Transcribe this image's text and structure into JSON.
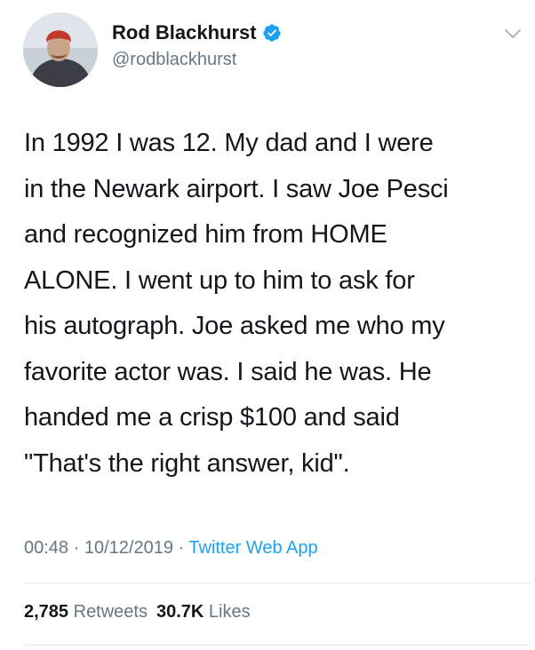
{
  "user": {
    "display_name": "Rod Blackhurst",
    "handle": "@rodblackhurst",
    "verified": true
  },
  "tweet": {
    "lines": [
      "In 1992 I was 12. My dad and I were",
      "in the Newark airport. I saw Joe Pesci",
      "and recognized him from HOME",
      "ALONE. I went up to him to ask for",
      "his autograph. Joe asked me who my",
      "favorite actor was. I said he was. He",
      "handed me a crisp $100 and said",
      "\"That's the right answer, kid\"."
    ]
  },
  "meta": {
    "time": "00:48",
    "separator": " · ",
    "date": "10/12/2019",
    "source": "Twitter Web App"
  },
  "stats": {
    "retweets_count": "2,785",
    "retweets_label": " Retweets",
    "likes_count": "30.7K",
    "likes_label": " Likes"
  },
  "colors": {
    "text": "#14171a",
    "secondary": "#657786",
    "accent": "#1da1f2",
    "divider": "#e1e8ed"
  },
  "icons": [
    "verified-badge-icon",
    "chevron-down-icon"
  ]
}
